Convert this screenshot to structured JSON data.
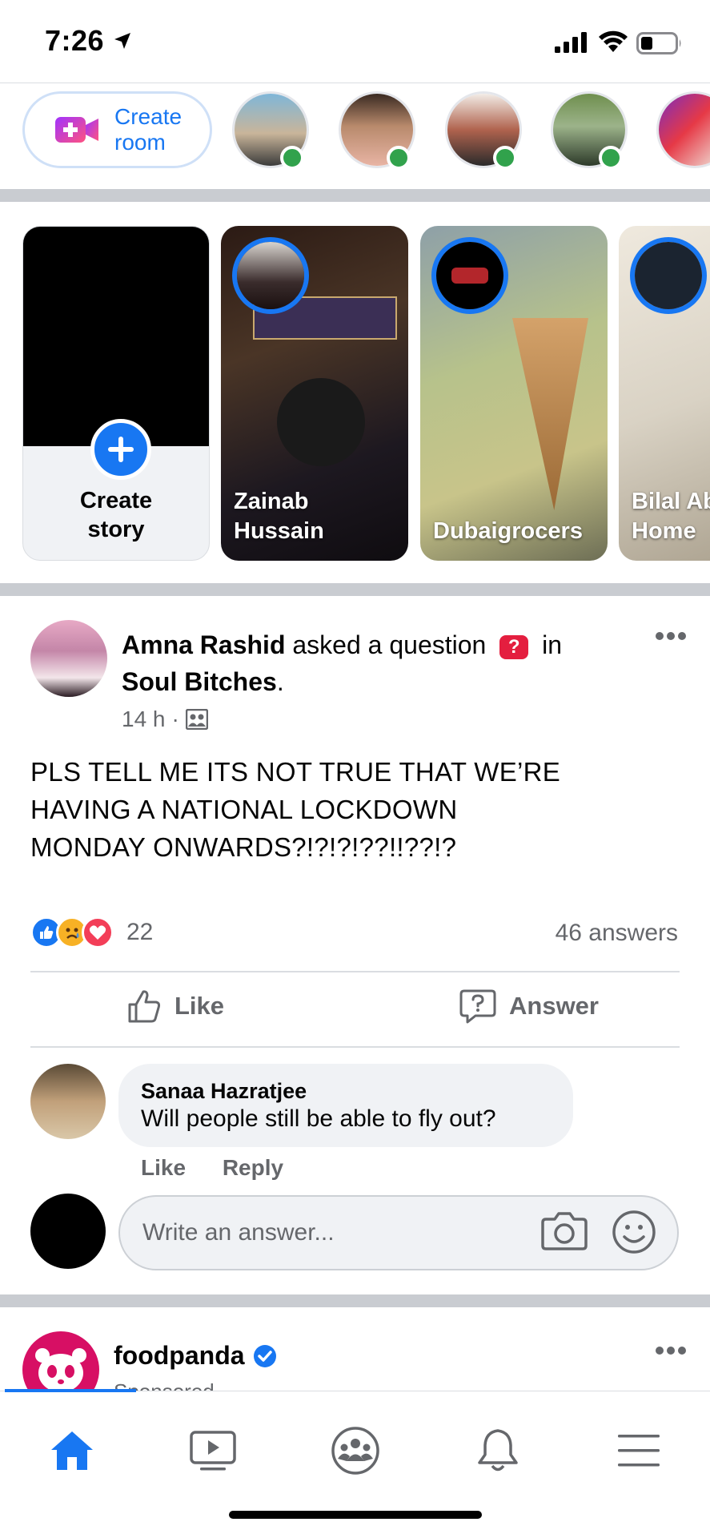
{
  "status_bar": {
    "time": "7:26"
  },
  "rooms": {
    "create_room_line1": "Create",
    "create_room_line2": "room",
    "accent_color": "#1877f2",
    "online_color": "#31a24c"
  },
  "stories": {
    "create_line1": "Create",
    "create_line2": "story",
    "items": [
      {
        "name_line1": "Zainab",
        "name_line2": "Hussain"
      },
      {
        "name_line1": "",
        "name_line2": "Dubaigrocers"
      },
      {
        "name_line1": "Bilal Ab",
        "name_line2": "Home"
      }
    ]
  },
  "post": {
    "author": "Amna Rashid",
    "action_text": "asked a question",
    "in_text": "in",
    "group": "Soul Bitches",
    "time": "14 h",
    "body_line1": "PLS TELL ME ITS NOT TRUE THAT WE’RE",
    "body_line2": "HAVING A NATIONAL LOCKDOWN",
    "body_line3": "MONDAY ONWARDS?!?!?!??!!??!?",
    "reaction_count": "22",
    "answers_count": "46 answers",
    "like_label": "Like",
    "answer_label": "Answer",
    "comment": {
      "author": "Sanaa Hazratjee",
      "text": "Will people still be able to fly out?",
      "like": "Like",
      "reply": "Reply"
    },
    "answer_placeholder": "Write an answer..."
  },
  "next_post": {
    "page_name": "foodpanda",
    "sub": "Sponsored ·",
    "brand_color": "#d70f64"
  },
  "tab_bar": {
    "items": [
      "home-icon",
      "watch-icon",
      "groups-icon",
      "notifications-icon",
      "menu-icon"
    ]
  }
}
